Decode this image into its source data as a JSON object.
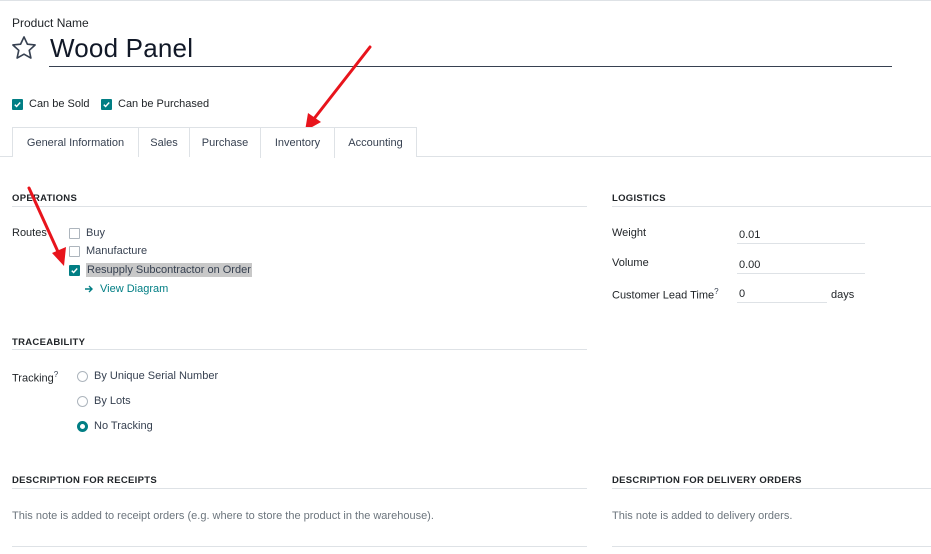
{
  "product": {
    "name_label": "Product Name",
    "name": "Wood Panel",
    "can_be_sold": "Can be Sold",
    "can_be_purchased": "Can be Purchased"
  },
  "tabs": [
    {
      "label": "General Information"
    },
    {
      "label": "Sales"
    },
    {
      "label": "Purchase"
    },
    {
      "label": "Inventory"
    },
    {
      "label": "Accounting"
    }
  ],
  "operations": {
    "title": "OPERATIONS",
    "routes_label": "Routes",
    "routes": [
      {
        "label": "Buy",
        "checked": false
      },
      {
        "label": "Manufacture",
        "checked": false
      },
      {
        "label": "Resupply Subcontractor on Order",
        "checked": true
      }
    ],
    "view_diagram": "View Diagram"
  },
  "logistics": {
    "title": "LOGISTICS",
    "weight_label": "Weight",
    "weight": "0.01",
    "volume_label": "Volume",
    "volume": "0.00",
    "lead_time_label": "Customer Lead Time",
    "lead_time": "0",
    "lead_time_unit": "days",
    "help_mark": "?"
  },
  "traceability": {
    "title": "TRACEABILITY",
    "tracking_label": "Tracking",
    "help_mark": "?",
    "options": [
      {
        "label": "By Unique Serial Number",
        "selected": false
      },
      {
        "label": "By Lots",
        "selected": false
      },
      {
        "label": "No Tracking",
        "selected": true
      }
    ]
  },
  "receipts": {
    "title": "DESCRIPTION FOR RECEIPTS",
    "placeholder": "This note is added to receipt orders (e.g. where to store the product in the warehouse)."
  },
  "delivery": {
    "title": "DESCRIPTION FOR DELIVERY ORDERS",
    "placeholder": "This note is added to delivery orders."
  },
  "colors": {
    "accent": "#017e84",
    "annotation_arrow": "#e8141c"
  }
}
